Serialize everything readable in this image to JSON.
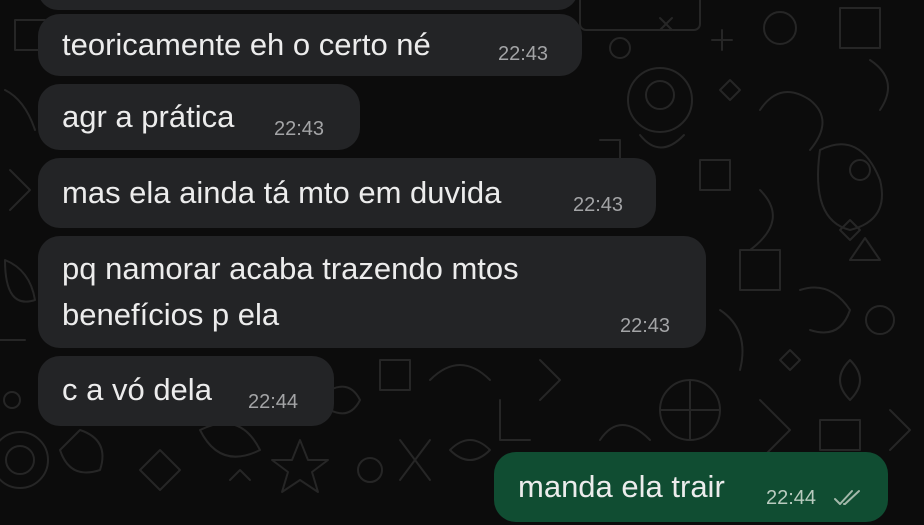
{
  "conversation": {
    "incoming": [
      {
        "text": "teoricamente eh o certo né",
        "time": "22:43"
      },
      {
        "text": "agr a prática",
        "time": "22:43"
      },
      {
        "text": "mas ela ainda tá mto em duvida",
        "time": "22:43"
      },
      {
        "text_line1": "pq namorar acaba trazendo mtos",
        "text_line2": "benefícios p ela",
        "time": "22:43"
      },
      {
        "text": "c a vó dela",
        "time": "22:44"
      }
    ],
    "outgoing": [
      {
        "text": "manda ela trair",
        "time": "22:44",
        "status_icon": "double-check-read"
      }
    ]
  },
  "colors": {
    "background": "#0c0c0c",
    "incoming_bubble": "#232426",
    "outgoing_bubble": "#104d32",
    "text": "#ececec",
    "timestamp": "#a3a4a6"
  }
}
